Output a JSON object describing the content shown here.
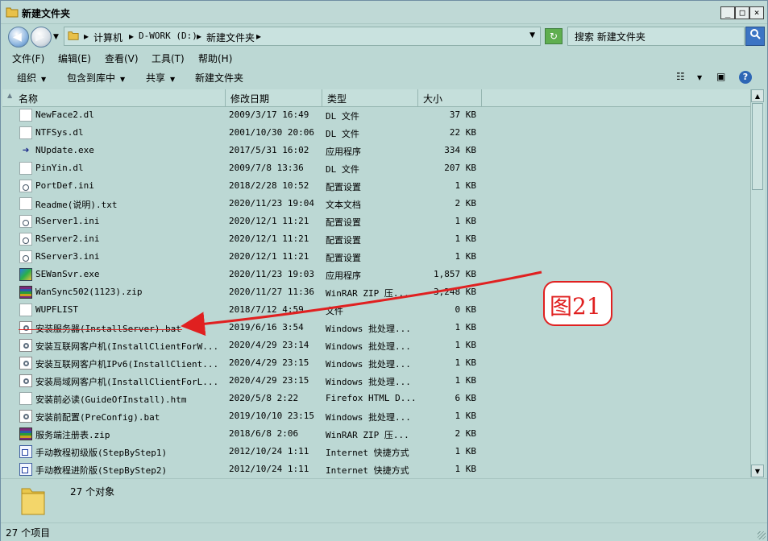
{
  "window": {
    "title": "新建文件夹",
    "min": "_",
    "max": "□",
    "close": "×"
  },
  "address": {
    "crumbs": [
      "计算机",
      "D-WORK (D:)",
      "新建文件夹"
    ]
  },
  "search": {
    "value": "搜索 新建文件夹"
  },
  "menu": [
    "文件(F)",
    "编辑(E)",
    "查看(V)",
    "工具(T)",
    "帮助(H)"
  ],
  "commands": {
    "organize": "组织",
    "include": "包含到库中",
    "share": "共享",
    "newfolder": "新建文件夹"
  },
  "columns": {
    "name": "名称",
    "date": "修改日期",
    "type": "类型",
    "size": "大小"
  },
  "files": [
    {
      "name": "NewFace2.dl",
      "date": "2009/3/17 16:49",
      "type": "DL 文件",
      "size": "37 KB",
      "icon": "doc-icon"
    },
    {
      "name": "NTFSys.dl",
      "date": "2001/10/30 20:06",
      "type": "DL 文件",
      "size": "22 KB",
      "icon": "doc-icon"
    },
    {
      "name": "NUpdate.exe",
      "date": "2017/5/31 16:02",
      "type": "应用程序",
      "size": "334 KB",
      "icon": "arrow-app-icon"
    },
    {
      "name": "PinYin.dl",
      "date": "2009/7/8 13:36",
      "type": "DL 文件",
      "size": "207 KB",
      "icon": "doc-icon"
    },
    {
      "name": "PortDef.ini",
      "date": "2018/2/28 10:52",
      "type": "配置设置",
      "size": "1 KB",
      "icon": "config-icon"
    },
    {
      "name": "Readme(说明).txt",
      "date": "2020/11/23 19:04",
      "type": "文本文档",
      "size": "2 KB",
      "icon": "doc-icon"
    },
    {
      "name": "RServer1.ini",
      "date": "2020/12/1 11:21",
      "type": "配置设置",
      "size": "1 KB",
      "icon": "config-icon"
    },
    {
      "name": "RServer2.ini",
      "date": "2020/12/1 11:21",
      "type": "配置设置",
      "size": "1 KB",
      "icon": "config-icon"
    },
    {
      "name": "RServer3.ini",
      "date": "2020/12/1 11:21",
      "type": "配置设置",
      "size": "1 KB",
      "icon": "config-icon"
    },
    {
      "name": "SEWanSvr.exe",
      "date": "2020/11/23 19:03",
      "type": "应用程序",
      "size": "1,857 KB",
      "icon": "exe-icon"
    },
    {
      "name": "WanSync502(1123).zip",
      "date": "2020/11/27 11:36",
      "type": "WinRAR ZIP 压...",
      "size": "3,248 KB",
      "icon": "zip-icon"
    },
    {
      "name": "WUPFLIST",
      "date": "2018/7/12 4:59",
      "type": "文件",
      "size": "0 KB",
      "icon": "doc-icon"
    },
    {
      "name": "安装服务器(InstallServer).bat",
      "date": "2019/6/16 3:54",
      "type": "Windows 批处理...",
      "size": "1 KB",
      "icon": "bat-icon"
    },
    {
      "name": "安装互联网客户机(InstallClientForW...",
      "date": "2020/4/29 23:14",
      "type": "Windows 批处理...",
      "size": "1 KB",
      "icon": "bat-icon"
    },
    {
      "name": "安装互联网客户机IPv6(InstallClient...",
      "date": "2020/4/29 23:15",
      "type": "Windows 批处理...",
      "size": "1 KB",
      "icon": "bat-icon"
    },
    {
      "name": "安装局域网客户机(InstallClientForL...",
      "date": "2020/4/29 23:15",
      "type": "Windows 批处理...",
      "size": "1 KB",
      "icon": "bat-icon"
    },
    {
      "name": "安装前必读(GuideOfInstall).htm",
      "date": "2020/5/8 2:22",
      "type": "Firefox HTML D...",
      "size": "6 KB",
      "icon": "html-icon"
    },
    {
      "name": "安装前配置(PreConfig).bat",
      "date": "2019/10/10 23:15",
      "type": "Windows 批处理...",
      "size": "1 KB",
      "icon": "bat-icon"
    },
    {
      "name": "服务端注册表.zip",
      "date": "2018/6/8 2:06",
      "type": "WinRAR ZIP 压...",
      "size": "2 KB",
      "icon": "zip-icon"
    },
    {
      "name": "手动教程初级版(StepByStep1)",
      "date": "2012/10/24 1:11",
      "type": "Internet 快捷方式",
      "size": "1 KB",
      "icon": "shortcut-icon"
    },
    {
      "name": "手动教程进阶版(StepByStep2)",
      "date": "2012/10/24 1:11",
      "type": "Internet 快捷方式",
      "size": "1 KB",
      "icon": "shortcut-icon"
    }
  ],
  "details": {
    "count": "27 个对象"
  },
  "status": {
    "items": "27 个项目"
  },
  "annotation": {
    "label": "图21",
    "color": "#e02020"
  }
}
